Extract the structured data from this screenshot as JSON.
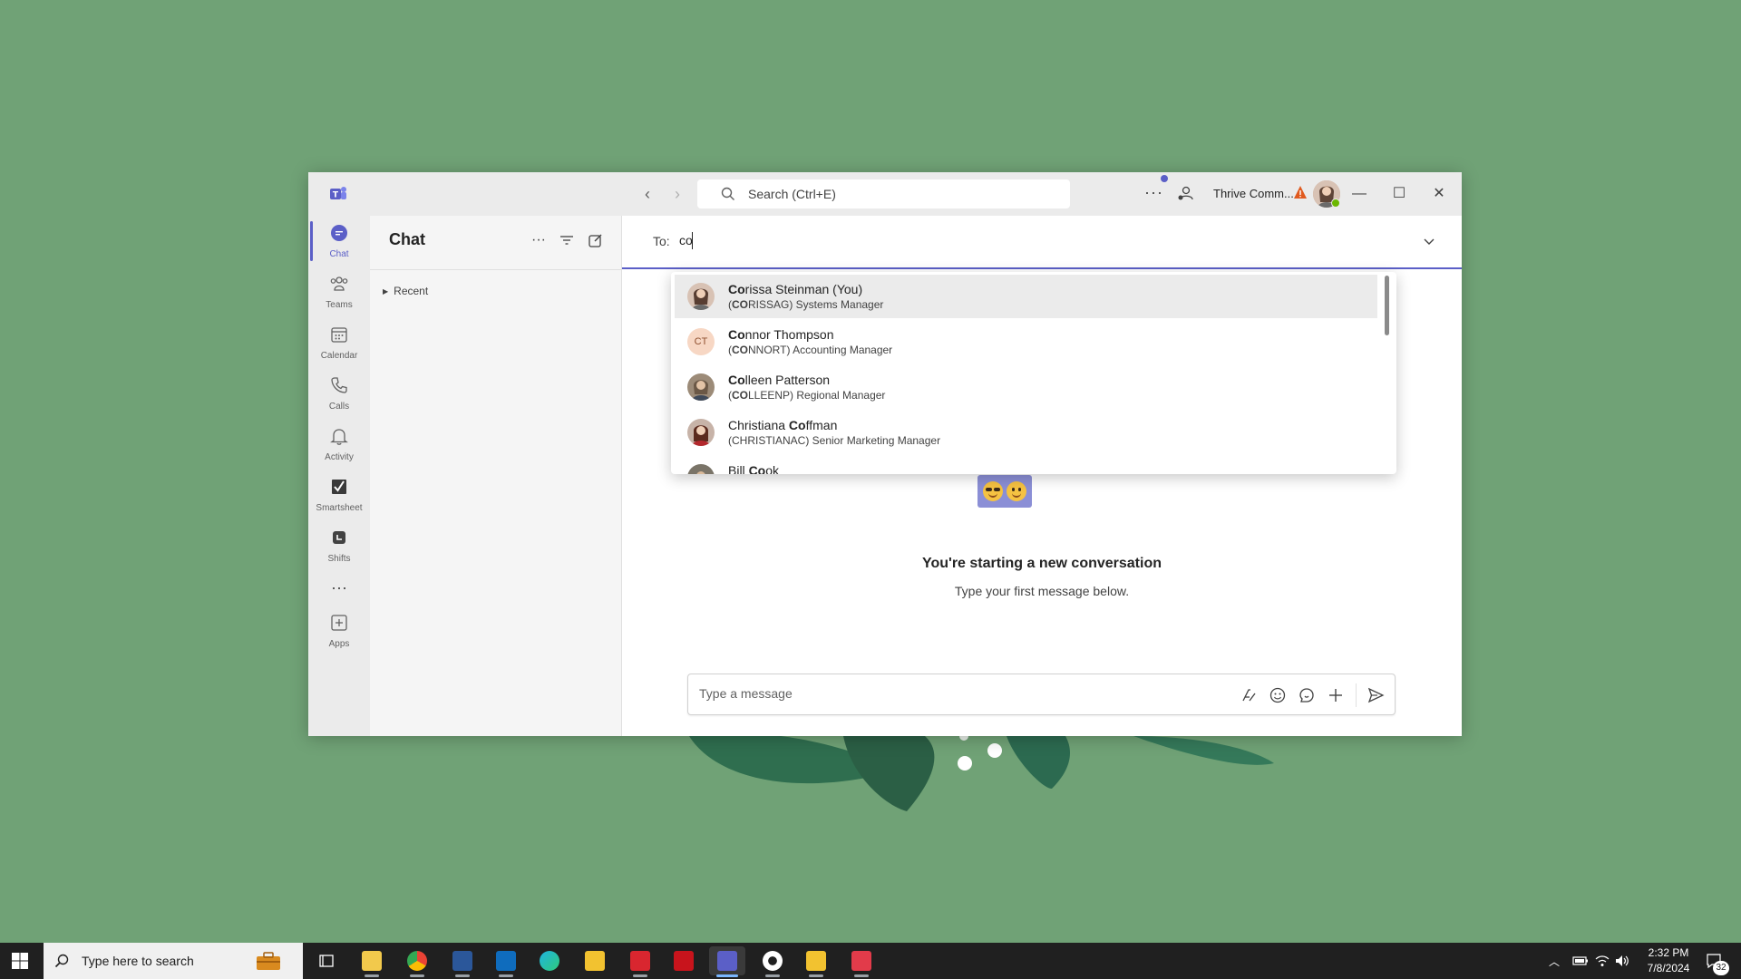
{
  "window": {
    "search_placeholder": "Search (Ctrl+E)",
    "org_name": "Thrive Comm...",
    "accent": "#5b5fc7"
  },
  "rail": {
    "items": [
      {
        "label": "Chat",
        "icon": "chat-icon"
      },
      {
        "label": "Teams",
        "icon": "teams-icon"
      },
      {
        "label": "Calendar",
        "icon": "calendar-icon"
      },
      {
        "label": "Calls",
        "icon": "phone-icon"
      },
      {
        "label": "Activity",
        "icon": "bell-icon"
      },
      {
        "label": "Smartsheet",
        "icon": "smartsheet-icon"
      },
      {
        "label": "Shifts",
        "icon": "shifts-icon"
      },
      {
        "label": "Apps",
        "icon": "add-apps-icon"
      }
    ]
  },
  "chatpane": {
    "title": "Chat",
    "recent_label": "Recent"
  },
  "compose_to": {
    "label": "To:",
    "value": "co"
  },
  "suggestions": [
    {
      "name_match": "Co",
      "name_rest": "rissa Steinman (You)",
      "sub_pre": "(",
      "sub_match": "CO",
      "sub_rest": "RISSAG) Systems Manager",
      "initials": ""
    },
    {
      "name_match": "Co",
      "name_rest": "nnor Thompson",
      "sub_pre": "(",
      "sub_match": "CO",
      "sub_rest": "NNORT) Accounting Manager",
      "initials": "CT"
    },
    {
      "name_match": "Co",
      "name_rest": "lleen Patterson",
      "sub_pre": "(",
      "sub_match": "CO",
      "sub_rest": "LLEENP) Regional Manager",
      "initials": ""
    },
    {
      "name_pre": "Christiana ",
      "name_match": "Co",
      "name_rest": "ffman",
      "sub_pre": "",
      "sub_match": "",
      "sub_rest": "(CHRISTIANAC) Senior Marketing Manager",
      "initials": ""
    },
    {
      "name_pre": "Bill ",
      "name_match": "Co",
      "name_rest": "ok",
      "sub_pre": "",
      "sub_match": "",
      "sub_rest": "",
      "initials": ""
    }
  ],
  "conversation": {
    "title": "You're starting a new conversation",
    "subtitle": "Type your first message below."
  },
  "compose": {
    "placeholder": "Type a message"
  },
  "taskbar": {
    "search_text": "Type here to search",
    "time": "2:32 PM",
    "date": "7/8/2024",
    "notification_count": "32"
  }
}
